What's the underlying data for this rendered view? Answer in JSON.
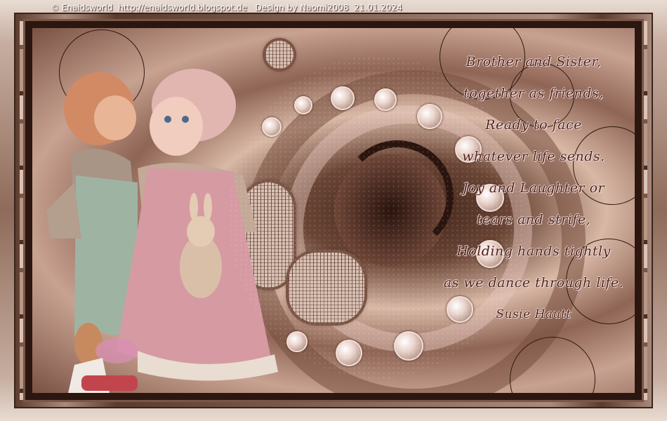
{
  "header": {
    "credit": "© Enaidsworld  http://enaidsworld.blogspot.de   Design by Naomi2008  21.01.2024"
  },
  "poem": {
    "lines": [
      "Brother and Sister,",
      "together as friends,",
      "Ready to face",
      "whatever life sends.",
      "Joy and Laughter or",
      "tears and strife,",
      "Holding hands tightly",
      "as we dance through life."
    ],
    "signature": "Susie Hautt"
  },
  "colors": {
    "frame": "#6b4a3a",
    "accent": "#c7aea1",
    "text": "#4e2618",
    "text_glow": "#f4dfe0"
  }
}
